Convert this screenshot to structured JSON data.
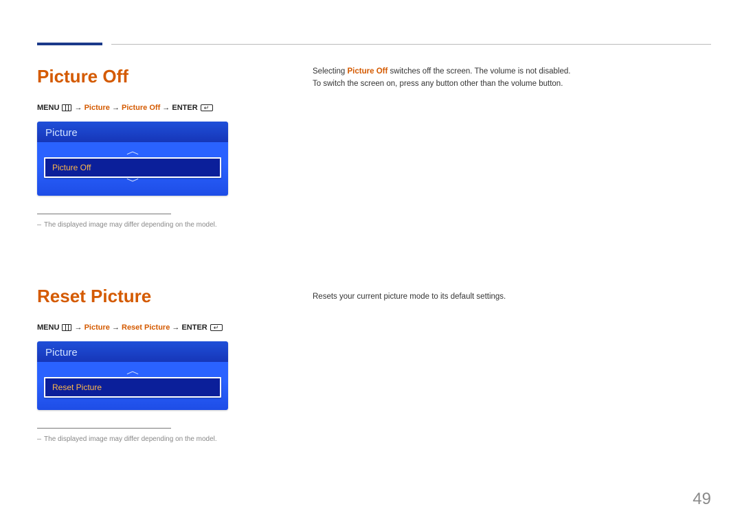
{
  "page_number": "49",
  "section1": {
    "title": "Picture Off",
    "path": {
      "menu_label": "MENU",
      "seg1": "Picture",
      "seg2": "Picture Off",
      "enter_label": "ENTER"
    },
    "osd": {
      "header": "Picture",
      "item": "Picture Off"
    },
    "footnote": "The displayed image may differ depending on the model.",
    "body_pre": "Selecting ",
    "body_accent": "Picture Off",
    "body_post": " switches off the screen. The volume is not disabled.",
    "body_line2": "To switch the screen on, press any button other than the volume button."
  },
  "section2": {
    "title": "Reset Picture",
    "path": {
      "menu_label": "MENU",
      "seg1": "Picture",
      "seg2": "Reset Picture",
      "enter_label": "ENTER"
    },
    "osd": {
      "header": "Picture",
      "item": "Reset Picture"
    },
    "footnote": "The displayed image may differ depending on the model.",
    "body": "Resets your current picture mode to its default settings."
  }
}
